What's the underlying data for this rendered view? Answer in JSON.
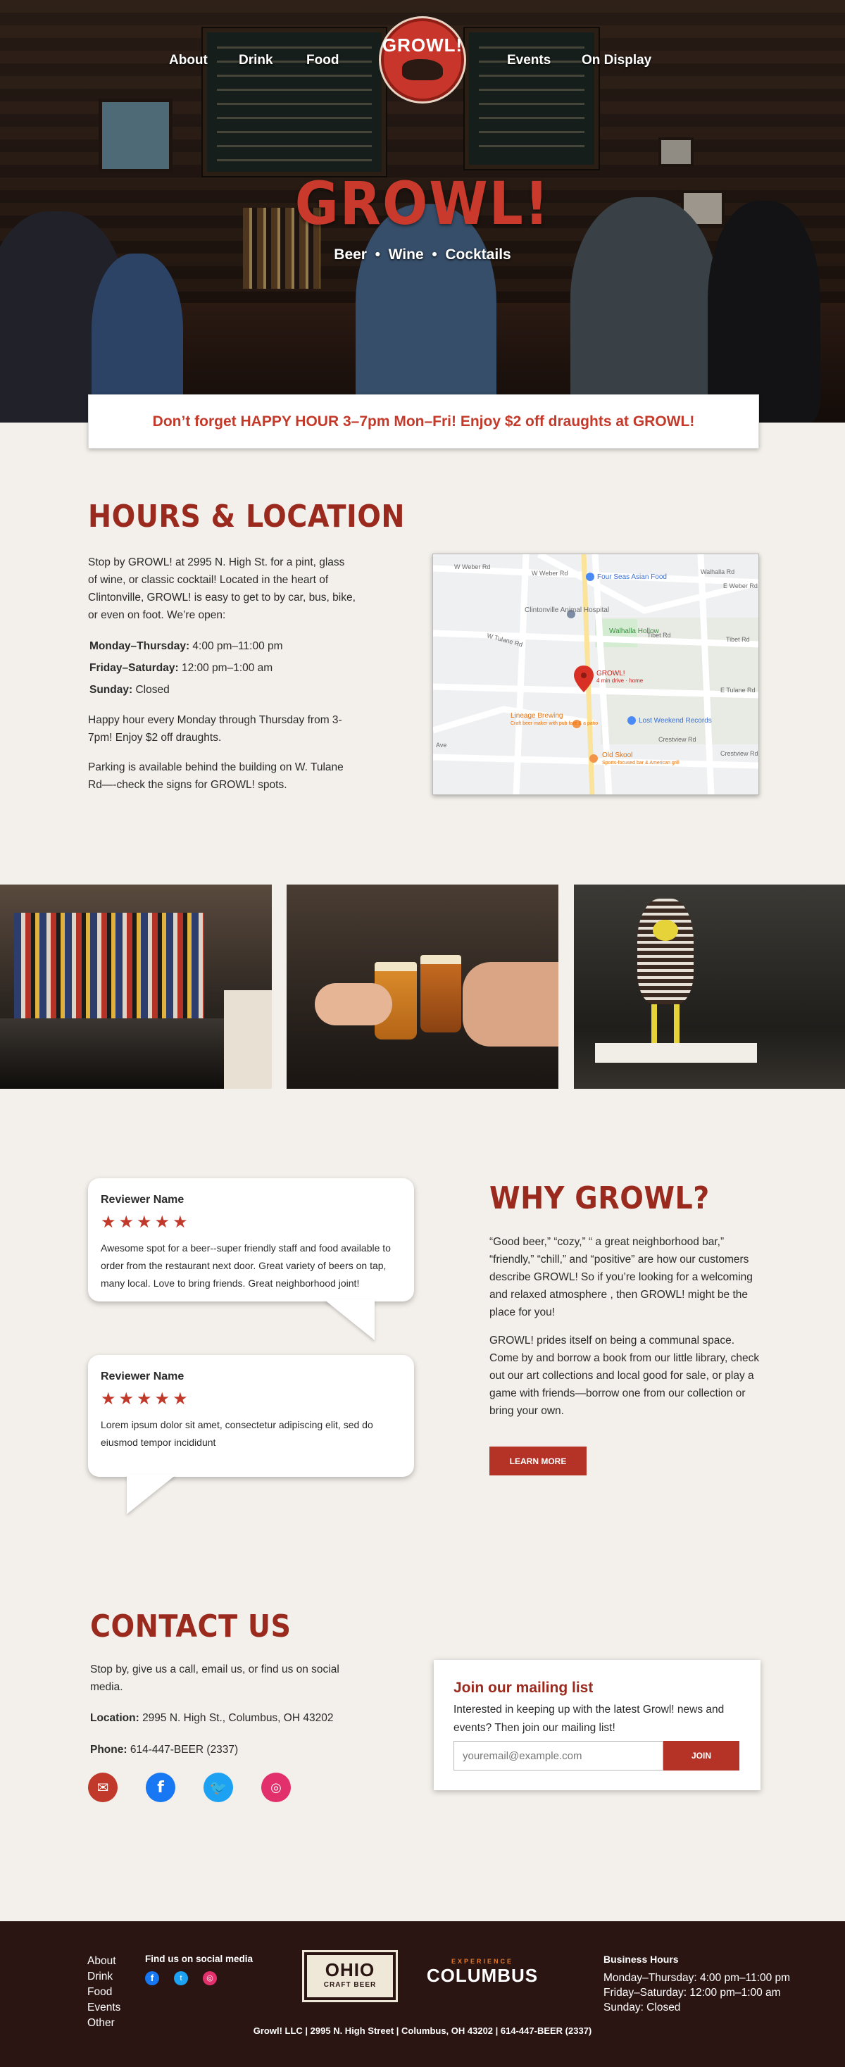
{
  "nav": {
    "items": [
      "About",
      "Drink",
      "Food",
      "Events",
      "On Display"
    ]
  },
  "logo": {
    "text": "GROWL!"
  },
  "hero": {
    "title": "GROWL!",
    "subtitle": "Beer  •  Wine  •  Cocktails"
  },
  "banner": {
    "text": "Don’t forget HAPPY HOUR 3–7pm Mon–Fri! Enjoy $2 off draughts at GROWL!"
  },
  "hours": {
    "title": "HOURS & LOCATION",
    "intro": "Stop by GROWL! at 2995 N. High St. for a pint, glass of wine, or classic cocktail! Located in the heart of Clintonville, GROWL! is easy to get to by car, bus, bike, or even on foot. We’re open:",
    "schedule": [
      {
        "day": "Monday–Thursday:",
        "time": "4:00 pm–11:00 pm"
      },
      {
        "day": "Friday–Saturday:",
        "time": "12:00 pm–1:00 am"
      },
      {
        "day": "Sunday:",
        "time": "Closed"
      }
    ],
    "happy": "Happy hour every Monday through Thursday from 3-7pm! Enjoy $2 off draughts.",
    "parking": "Parking is available behind the building on W. Tulane Rd—-check the signs for GROWL! spots."
  },
  "map": {
    "streets": [
      "W Weber Rd",
      "W Weber Rd",
      "Walhalla Rd",
      "E Weber Rd",
      "Tibet Rd",
      "Tibet Rd",
      "W Tulane Rd",
      "E Tulane Rd",
      "Crestview Rd",
      "Crestview Rd",
      "Ave"
    ],
    "places": [
      {
        "name": "Four Seas Asian Food"
      },
      {
        "name": "Clintonville Animal Hospital"
      },
      {
        "name": "Walhalla Hollow"
      },
      {
        "name": "GROWL!",
        "sub": "4 min drive · home"
      },
      {
        "name": "Lineage Brewing",
        "sub": "Craft beer maker with pub fare & a patio"
      },
      {
        "name": "Lost Weekend Records"
      },
      {
        "name": "Old Skool",
        "sub": "Sports-focused bar & American grill"
      }
    ]
  },
  "reviews": [
    {
      "name": "Reviewer Name",
      "stars": "★★★★★",
      "text": "Awesome spot for a beer--super friendly staff and food available to order from the restaurant next door. Great variety of beers on tap, many local. Love to bring friends. Great neighborhood joint!"
    },
    {
      "name": "Reviewer Name",
      "stars": "★★★★★",
      "text": "Lorem ipsum dolor sit amet, consectetur adipiscing elit, sed do eiusmod tempor incididunt"
    }
  ],
  "why": {
    "title": "WHY GROWL?",
    "p1": "“Good beer,” “cozy,” “ a great neighborhood bar,” “friendly,” “chill,” and “positive” are how our customers describe GROWL! So if you’re looking for a welcoming and relaxed atmosphere , then GROWL! might be the place for you!",
    "p2": "GROWL! prides itself on being a communal space. Come by and borrow a book from our little library, check out our art collections and local good for sale, or play a game with friends—borrow one from our collection or bring your own.",
    "button": "LEARN MORE"
  },
  "contact": {
    "title": "CONTACT US",
    "intro": "Stop by, give us a call, email us, or find us on social media.",
    "location_label": "Location:",
    "location": "2995 N. High St., Columbus, OH 43202",
    "phone_label": "Phone:",
    "phone": "614-447-BEER (2337)"
  },
  "mailing": {
    "title": "Join our mailing list",
    "text": "Interested in keeping up with the latest Growl! news and events? Then join our mailing list!",
    "placeholder": "youremail@example.com",
    "button": "JOIN"
  },
  "footer": {
    "links": [
      "About",
      "Drink",
      "Food",
      "Events",
      "Other"
    ],
    "social_title": "Find us on social media",
    "ohio_top": "OHIO",
    "ohio_bottom": "CRAFT BEER",
    "columbus_top": "EXPERIENCE",
    "columbus": "COLUMBUS",
    "hours_title": "Business Hours",
    "hours": [
      "Monday–Thursday: 4:00 pm–11:00 pm",
      "Friday–Saturday: 12:00 pm–1:00 am",
      "Sunday: Closed"
    ],
    "bottom": "Growl! LLC | 2995 N. High Street | Columbus, OH 43202 | 614-447-BEER (2337)"
  },
  "colors": {
    "accent": "#b53326",
    "heading": "#9b2a1e",
    "background": "#f3efea",
    "footer": "#2a1513"
  }
}
